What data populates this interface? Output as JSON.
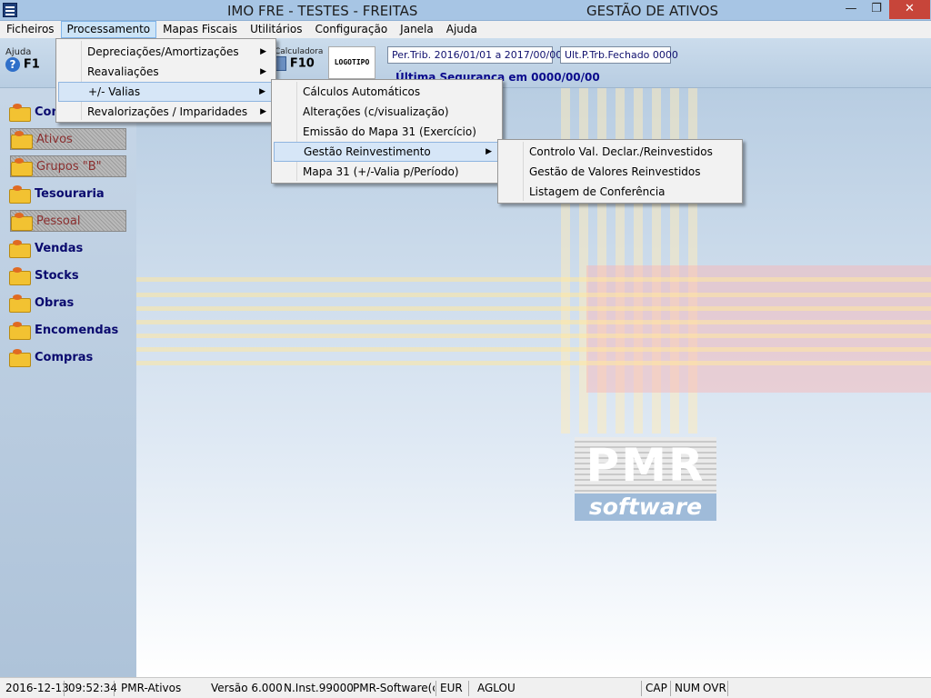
{
  "titlebar": {
    "title": "IMO FRE - TESTES - FREITAS",
    "title_right": "GESTÃO DE ATIVOS",
    "minimize": "—",
    "maximize": "❐",
    "close": "✕"
  },
  "menubar": {
    "items": [
      "Ficheiros",
      "Processamento",
      "Mapas Fiscais",
      "Utilitários",
      "Configuração",
      "Janela",
      "Ajuda"
    ]
  },
  "toolbar": {
    "help_label": "Ajuda",
    "help_key": "F1",
    "calc_label": "Calculadora",
    "calc_key": "F10",
    "logo_text": "LOGOTIPO",
    "periodo": "Per.Trib. 2016/01/01 a 2017/00/00",
    "ult_periodo": "Ult.P.Trb.Fechado 0000",
    "ultima_seguranca": "Última Segurança em   0000/00/00"
  },
  "sidebar": {
    "items": [
      {
        "label": "Contabilidade",
        "state": "enabled"
      },
      {
        "label": "Ativos",
        "state": "disabled"
      },
      {
        "label": "Grupos \"B\"",
        "state": "disabled"
      },
      {
        "label": "Tesouraria",
        "state": "enabled"
      },
      {
        "label": "Pessoal",
        "state": "disabled"
      },
      {
        "label": "Vendas",
        "state": "enabled"
      },
      {
        "label": "Stocks",
        "state": "enabled"
      },
      {
        "label": "Obras",
        "state": "enabled"
      },
      {
        "label": "Encomendas",
        "state": "enabled"
      },
      {
        "label": "Compras",
        "state": "enabled"
      }
    ]
  },
  "menu_processamento": {
    "items": [
      "Depreciações/Amortizações",
      "Reavaliações",
      "+/- Valias",
      "Revalorizações / Imparidades"
    ]
  },
  "menu_valias": {
    "items": [
      "Cálculos Automáticos",
      "Alterações (c/visualização)",
      "Emissão do Mapa 31 (Exercício)",
      "Gestão Reinvestimento",
      "Mapa 31 (+/-Valia p/Período)"
    ]
  },
  "menu_reinvestimento": {
    "items": [
      "Controlo Val. Declar./Reinvestidos",
      "Gestão de Valores Reinvestidos",
      "Listagem de Conferência"
    ]
  },
  "logo": {
    "top": "PMR",
    "bottom": "software"
  },
  "statusbar": {
    "date": "2016-12-13",
    "time": "09:52:34",
    "app": "PMR-Ativos",
    "version": "Versão  6.000",
    "inst": "N.Inst.99000",
    "company": "PMR-Software(c)",
    "currency": "EUR",
    "user": "AGLOU",
    "cap": "CAP",
    "num": "NUM",
    "ovr": "OVR"
  },
  "colors": {
    "titlebar": "#a7c5e4",
    "menu_highlight": "#cce4f7",
    "sidebar_text": "#0a0a6e",
    "close_button": "#c7453a"
  }
}
